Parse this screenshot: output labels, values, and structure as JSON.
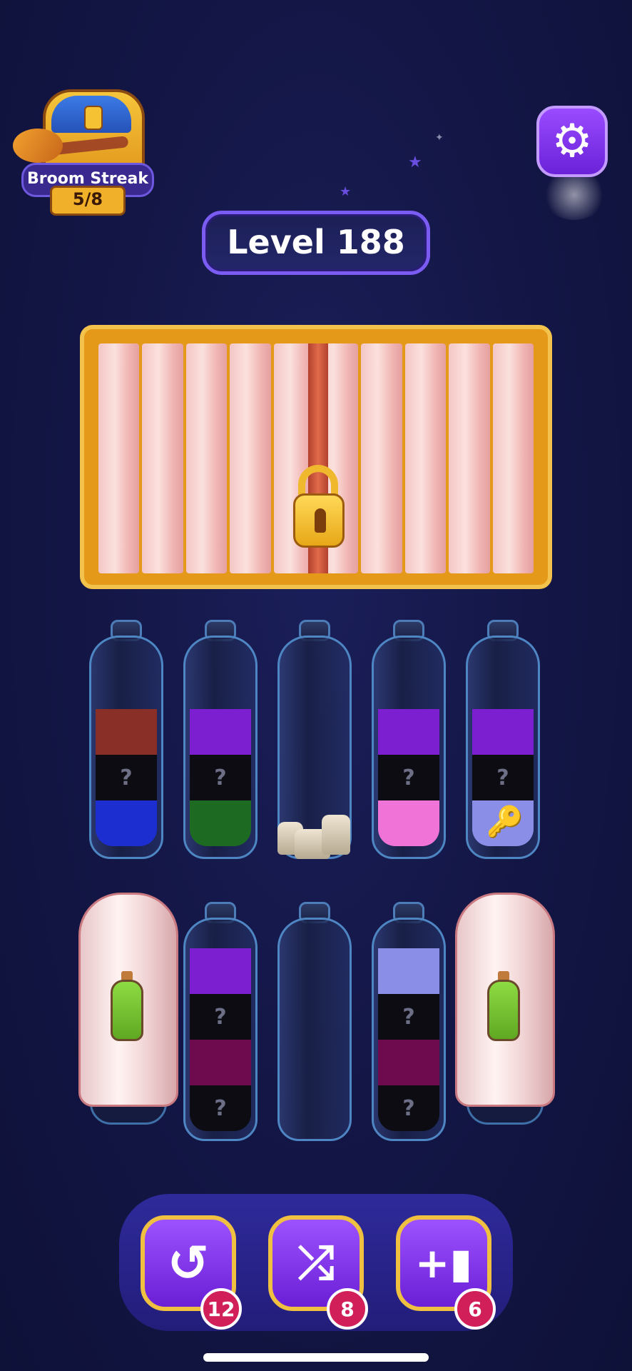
{
  "streak": {
    "label": "Broom Streak",
    "progress": "5/8",
    "value": 5,
    "total": 8
  },
  "level": {
    "label": "Level 188"
  },
  "colors": {
    "accent_purple": "#8a3ffc",
    "gold": "#f0c041",
    "badge_red": "#d11f59",
    "red": "#8a2e28",
    "violet": "#7b1fd0",
    "blue": "#1d2ed0",
    "green": "#1d6a22",
    "pink": "#f073d8",
    "lavender": "#8a8ee6",
    "magenta": "#6e0a4e",
    "black": "#0c0c12"
  },
  "bottles_row1": [
    {
      "layers": [
        "red",
        "hidden",
        "blue"
      ]
    },
    {
      "layers": [
        "violet",
        "hidden",
        "green"
      ]
    },
    {
      "layers": [],
      "obstacle": "rock-icon"
    },
    {
      "layers": [
        "violet",
        "hidden",
        "pink"
      ]
    },
    {
      "layers": [
        "violet",
        "hidden",
        "lavender"
      ],
      "item": "key-icon"
    }
  ],
  "bottles_row2": [
    {
      "covered": true
    },
    {
      "layers": [
        "violet",
        "hidden",
        "magenta",
        "hidden"
      ]
    },
    {
      "layers": []
    },
    {
      "layers": [
        "lavender",
        "hidden",
        "magenta",
        "hidden"
      ]
    },
    {
      "covered": true
    }
  ],
  "hidden_mark": "?",
  "tools": {
    "undo": {
      "icon": "undo-icon",
      "count": "12"
    },
    "shuffle": {
      "icon": "shuffle-icon",
      "count": "8"
    },
    "add_bottle": {
      "icon": "add-bottle-icon",
      "count": "6"
    }
  }
}
